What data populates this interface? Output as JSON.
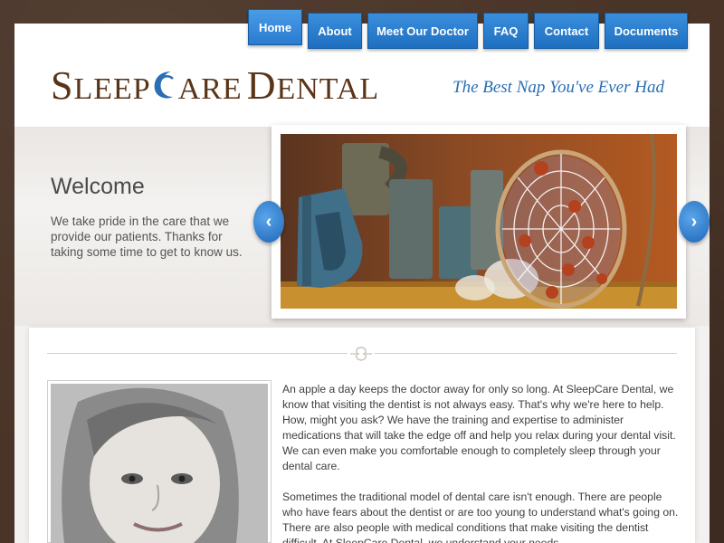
{
  "header": {
    "logo_text": "SleepCare Dental",
    "logo_s": "S",
    "logo_leep": "LEEP",
    "logo_are": "ARE",
    "logo_d": "D",
    "logo_ental": "ENTAL",
    "tagline": "The Best Nap You've Ever Had"
  },
  "nav": {
    "items": [
      {
        "label": "Home"
      },
      {
        "label": "About"
      },
      {
        "label": "Meet Our Doctor"
      },
      {
        "label": "FAQ"
      },
      {
        "label": "Contact"
      },
      {
        "label": "Documents"
      }
    ],
    "active_index": 0
  },
  "hero": {
    "title": "Welcome",
    "text": "We take pride in the care that we provide our patients.  Thanks for taking some time to get to know us.",
    "prev_icon": "chevron-left-icon",
    "next_icon": "chevron-right-icon"
  },
  "content": {
    "paragraphs": [
      "An apple a day keeps the doctor away for only so long.  At SleepCare Dental, we know that visiting the dentist is not always easy.  That's why we're here to help.  How, might you ask?  We have the training and expertise to administer medications that will take the edge off and help you relax during your dental visit.  We can even make you comfortable enough to completely sleep through your dental care.",
      "Sometimes the traditional model of dental care isn't enough.  There are people who have fears about the dentist or are too young to understand what's going on.  There are also people with medical conditions that make visiting the dentist difficult.  At SleepCare Dental, we understand your needs."
    ]
  },
  "colors": {
    "brand_brown": "#5a3418",
    "accent_blue": "#2a6fb5",
    "nav_blue": "#2a7bd0"
  }
}
